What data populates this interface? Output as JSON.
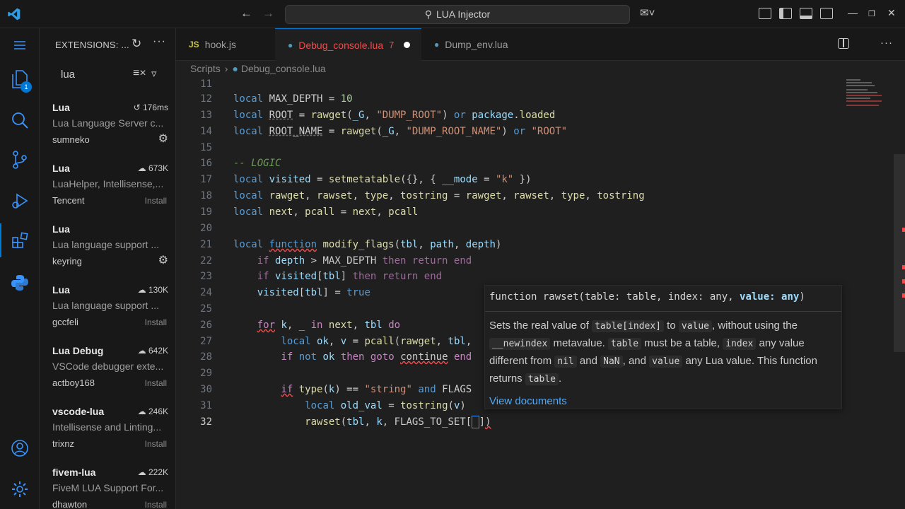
{
  "titlebar": {
    "search_text": "LUA Injector"
  },
  "activity": {
    "explorer_badge": "1"
  },
  "sidebar": {
    "header": "EXTENSIONS: ...",
    "search_value": "lua",
    "extensions": [
      {
        "name": "Lua",
        "stat": "176ms",
        "stat_icon": "history-icon",
        "desc": "Lua Language Server c...",
        "publisher": "sumneko",
        "action": "gear"
      },
      {
        "name": "Lua",
        "stat": "673K",
        "stat_icon": "cloud-download-icon",
        "desc": "LuaHelper, Intellisense,...",
        "publisher": "Tencent",
        "action": "Install"
      },
      {
        "name": "Lua",
        "stat": "",
        "stat_icon": "",
        "desc": "Lua language support ...",
        "publisher": "keyring",
        "action": "gear"
      },
      {
        "name": "Lua",
        "stat": "130K",
        "stat_icon": "cloud-download-icon",
        "desc": "Lua language support ...",
        "publisher": "gccfeli",
        "action": "Install"
      },
      {
        "name": "Lua Debug",
        "stat": "642K",
        "stat_icon": "cloud-download-icon",
        "desc": "VSCode debugger exte...",
        "publisher": "actboy168",
        "action": "Install"
      },
      {
        "name": "vscode-lua",
        "stat": "246K",
        "stat_icon": "cloud-download-icon",
        "desc": "Intellisense and Linting...",
        "publisher": "trixnz",
        "action": "Install"
      },
      {
        "name": "fivem-lua",
        "stat": "222K",
        "stat_icon": "cloud-download-icon",
        "desc": "FiveM LUA Support For...",
        "publisher": "dhawton",
        "action": "Install"
      }
    ]
  },
  "tabs": [
    {
      "icon": "JS",
      "label": "hook.js"
    },
    {
      "icon": "●",
      "label": "Debug_console.lua",
      "problems": "7"
    },
    {
      "icon": "●",
      "label": "Dump_env.lua"
    }
  ],
  "breadcrumb": [
    "Scripts",
    "Debug_console.lua"
  ],
  "editor": {
    "line_numbers": [
      "11",
      "12",
      "13",
      "14",
      "15",
      "16",
      "17",
      "18",
      "19",
      "20",
      "21",
      "22",
      "23",
      "24",
      "25",
      "26",
      "27",
      "28",
      "29",
      "30",
      "31",
      "32"
    ]
  },
  "hover": {
    "signature": "function rawset(table: table, index: any, value: any)",
    "link": "View documents"
  },
  "colors": {
    "accent": "#0078d4",
    "error": "#f14c4c",
    "link": "#4daafc"
  }
}
